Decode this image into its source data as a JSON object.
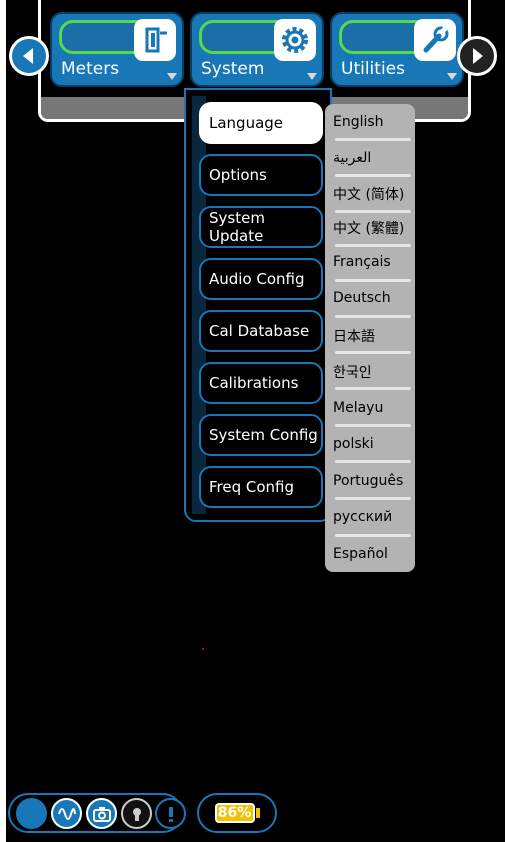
{
  "tabs": [
    {
      "label": "Meters",
      "icon": "meter-icon"
    },
    {
      "label": "System",
      "icon": "gear-icon"
    },
    {
      "label": "Utilities",
      "icon": "wrench-icon"
    }
  ],
  "system_menu": [
    "Language",
    "Options",
    "System Update",
    "Audio Config",
    "Cal Database",
    "Calibrations",
    "System Config",
    "Freq Config"
  ],
  "language_options": [
    "English",
    "العربية",
    "中文 (简体)",
    "中文 (繁體)",
    "Français",
    "Deutsch",
    "日本語",
    "한국인",
    "Melayu",
    "polski",
    "Português",
    "русский",
    "Español"
  ],
  "status": {
    "battery_percent": "86%"
  },
  "colors": {
    "accent": "#1877b6",
    "highlight": "#56d94a",
    "battery": "#f2c200"
  }
}
